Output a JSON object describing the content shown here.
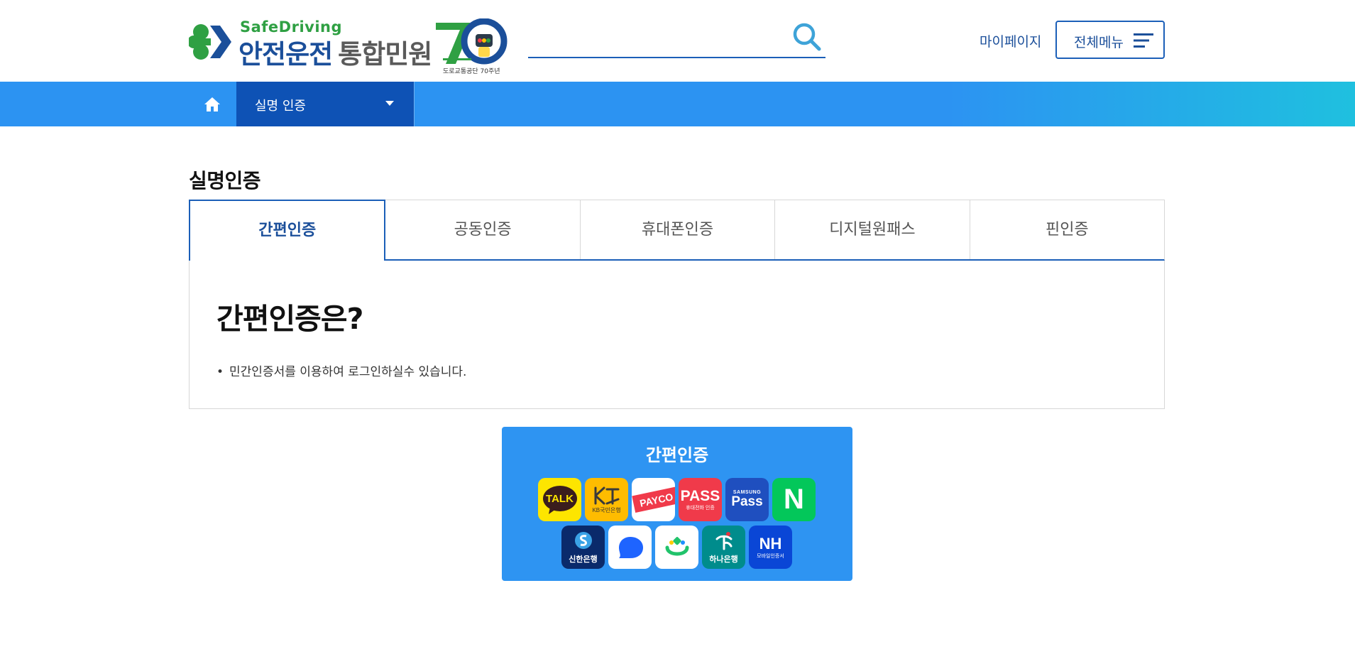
{
  "header": {
    "logo_safe": "SafeDriving",
    "logo_main": "안전운전",
    "logo_sub": "통합민원",
    "logo_70_caption": "도로교통공단 70주년",
    "search_placeholder": "",
    "mypage_label": "마이페이지",
    "allmenu_label": "전체메뉴"
  },
  "nav": {
    "selected": "실명 인증"
  },
  "page": {
    "title": "실명인증"
  },
  "tabs": [
    {
      "label": "간편인증",
      "active": true
    },
    {
      "label": "공동인증",
      "active": false
    },
    {
      "label": "휴대폰인증",
      "active": false
    },
    {
      "label": "디지털원패스",
      "active": false
    },
    {
      "label": "핀인증",
      "active": false
    }
  ],
  "info": {
    "title": "간편인증은?",
    "bullet": "민간인증서를 이용하여 로그인하실수 있습니다."
  },
  "auth_card": {
    "title": "간편인증",
    "providers_row1": [
      {
        "name": "kakao-talk",
        "label": "TALK",
        "bg": "#fde500",
        "fg": "#3a1d1d"
      },
      {
        "name": "kb-bank",
        "label": "KB국민은행",
        "bg": "#ffbc00",
        "fg": "#333333"
      },
      {
        "name": "payco",
        "label": "PAYCO",
        "bg": "#ffffff",
        "fg": "#ffffff"
      },
      {
        "name": "pass",
        "label": "PASS",
        "sub": "휴대전화 인증",
        "bg": "#f03a4a",
        "fg": "#ffffff"
      },
      {
        "name": "samsung-pass",
        "label": "Pass",
        "sub": "SAMSUNG",
        "bg": "#1f4fbf",
        "fg": "#ffffff"
      },
      {
        "name": "naver",
        "label": "N",
        "bg": "#03c75a",
        "fg": "#ffffff"
      }
    ],
    "providers_row2": [
      {
        "name": "shinhan-bank",
        "label": "신한은행",
        "bg": "#0a2a6b",
        "fg": "#ffffff"
      },
      {
        "name": "toss",
        "label": "",
        "bg": "#ffffff",
        "fg": "#1e64ff"
      },
      {
        "name": "banksalad",
        "label": "",
        "bg": "#ffffff",
        "fg": "#21c36b"
      },
      {
        "name": "hana-bank",
        "label": "하나은행",
        "bg": "#008c8c",
        "fg": "#ffffff"
      },
      {
        "name": "nh-bank",
        "label": "NH",
        "sub": "모바일인증서",
        "bg": "#0a46d6",
        "fg": "#ffffff"
      }
    ]
  },
  "colors": {
    "accent": "#1b5fb8",
    "nav_bg": "#2c93f2",
    "nav_selected_bg": "#0e52b5",
    "card_bg": "#2e94f2"
  }
}
